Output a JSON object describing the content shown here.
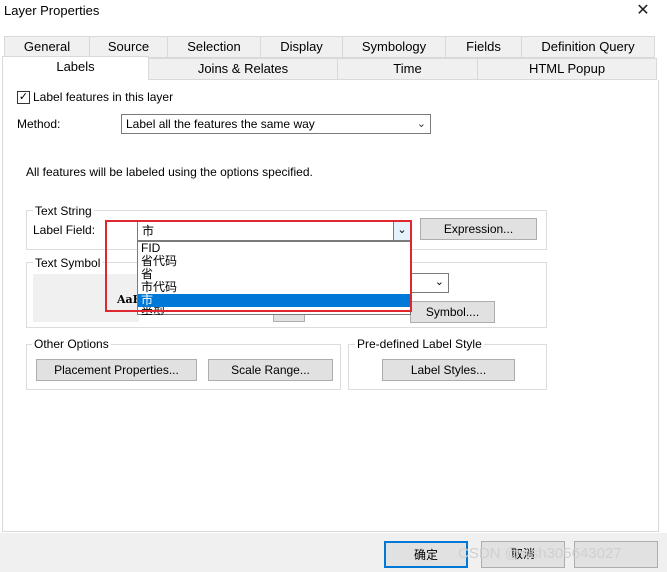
{
  "window": {
    "title": "Layer Properties",
    "close_glyph": "✕"
  },
  "tabs_row1": [
    "General",
    "Source",
    "Selection",
    "Display",
    "Symbology",
    "Fields",
    "Definition Query"
  ],
  "tabs_row2": [
    "Labels",
    "Joins & Relates",
    "Time",
    "HTML Popup"
  ],
  "label_features": {
    "checked": true,
    "label": "Label features in this layer"
  },
  "method": {
    "label": "Method:",
    "value": "Label all the features the same way"
  },
  "info_text": "All features will be labeled using the options specified.",
  "text_string": {
    "legend": "Text String",
    "field_label": "Label Field:",
    "field_value": "市",
    "expression_button": "Expression...",
    "dropdown_options": [
      "FID",
      "省代码",
      "省",
      "市代码",
      "市",
      "类型"
    ],
    "selected_index": 4
  },
  "text_symbol": {
    "legend": "Text Symbol",
    "preview": "AaB",
    "symbol_button": "Symbol...."
  },
  "other_options": {
    "legend": "Other Options",
    "placement_button": "Placement Properties...",
    "scale_button": "Scale Range..."
  },
  "predefined": {
    "legend": "Pre-defined Label Style",
    "label_styles_button": "Label Styles..."
  },
  "footer": {
    "ok": "确定",
    "cancel": "取消",
    "watermark": "CSDN @wsh305643027"
  },
  "colors": {
    "accent": "#0078d7",
    "highlight_box": "#e0262e"
  }
}
